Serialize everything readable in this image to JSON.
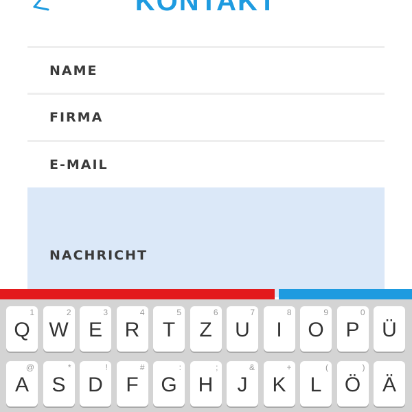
{
  "header": {
    "title": "KONTAKT"
  },
  "form": {
    "name_label": "NAME",
    "firma_label": "FIRMA",
    "email_label": "E-MAIL",
    "nachricht_label": "NACHRICHT"
  },
  "colors": {
    "accent": "#1e9be0",
    "red": "#e31a1c",
    "message_bg": "#dbe8f8"
  },
  "keyboard": {
    "row1": [
      {
        "main": "Q",
        "sub": "1"
      },
      {
        "main": "W",
        "sub": "2"
      },
      {
        "main": "E",
        "sub": "3"
      },
      {
        "main": "R",
        "sub": "4"
      },
      {
        "main": "T",
        "sub": "5"
      },
      {
        "main": "Z",
        "sub": "6"
      },
      {
        "main": "U",
        "sub": "7"
      },
      {
        "main": "I",
        "sub": "8"
      },
      {
        "main": "O",
        "sub": "9"
      },
      {
        "main": "P",
        "sub": "0"
      },
      {
        "main": "Ü",
        "sub": ""
      }
    ],
    "row2": [
      {
        "main": "A",
        "sub": "@"
      },
      {
        "main": "S",
        "sub": "*"
      },
      {
        "main": "D",
        "sub": "!"
      },
      {
        "main": "F",
        "sub": "#"
      },
      {
        "main": "G",
        "sub": ":"
      },
      {
        "main": "H",
        "sub": ";"
      },
      {
        "main": "J",
        "sub": "&"
      },
      {
        "main": "K",
        "sub": "+"
      },
      {
        "main": "L",
        "sub": "("
      },
      {
        "main": "Ö",
        "sub": ")"
      },
      {
        "main": "Ä",
        "sub": ""
      }
    ]
  }
}
